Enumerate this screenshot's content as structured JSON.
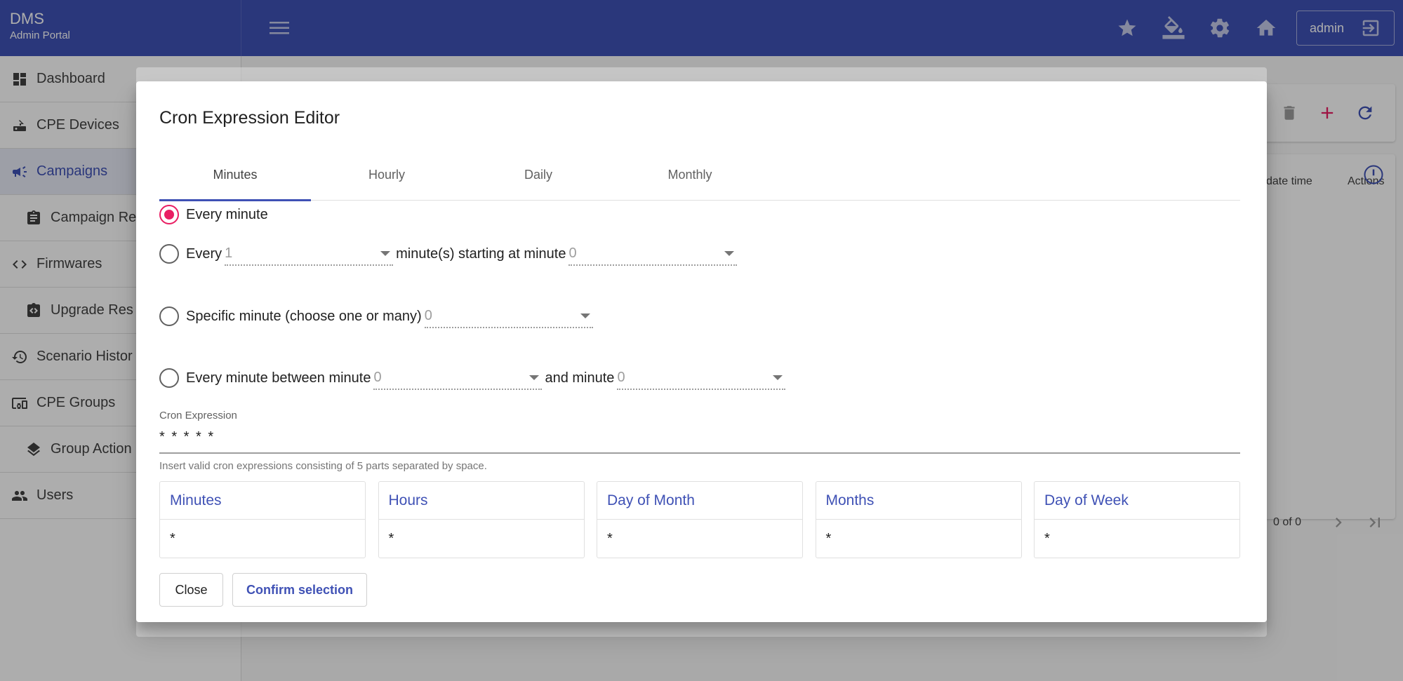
{
  "app": {
    "title": "DMS",
    "subtitle": "Admin Portal",
    "user_label": "admin"
  },
  "top_icons": [
    "star-icon",
    "paint-bucket-icon",
    "gear-icon",
    "home-icon"
  ],
  "sidebar": {
    "items": [
      {
        "label": "Dashboard",
        "icon": "dashboard-icon",
        "sub": false,
        "active": false
      },
      {
        "label": "CPE Devices",
        "icon": "router-icon",
        "sub": false,
        "active": false
      },
      {
        "label": "Campaigns",
        "icon": "megaphone-icon",
        "sub": false,
        "active": true
      },
      {
        "label": "Campaign Re",
        "icon": "clipboard-icon",
        "sub": true,
        "active": false
      },
      {
        "label": "Firmwares",
        "icon": "code-icon",
        "sub": false,
        "active": false
      },
      {
        "label": "Upgrade Res",
        "icon": "upgrade-icon",
        "sub": true,
        "active": false
      },
      {
        "label": "Scenario Histor",
        "icon": "history-icon",
        "sub": false,
        "active": false
      },
      {
        "label": "CPE Groups",
        "icon": "devices-icon",
        "sub": false,
        "active": false
      },
      {
        "label": "Group Action",
        "icon": "layers-icon",
        "sub": true,
        "active": false
      },
      {
        "label": "Users",
        "icon": "people-icon",
        "sub": false,
        "active": false
      }
    ]
  },
  "background": {
    "col_update_time": "date time",
    "col_actions": "Actions",
    "pagination": "0 of 0"
  },
  "dialog": {
    "title": "Cron Expression Editor",
    "tabs": [
      {
        "label": "Minutes",
        "active": true
      },
      {
        "label": "Hourly",
        "active": false
      },
      {
        "label": "Daily",
        "active": false
      },
      {
        "label": "Monthly",
        "active": false
      }
    ],
    "options": {
      "every_minute": "Every minute",
      "every": "Every",
      "every_value": "1",
      "starting_at": "minute(s) starting at minute",
      "starting_value": "0",
      "specific": "Specific minute (choose one or many)",
      "specific_value": "0",
      "between": "Every minute between minute",
      "between_from": "0",
      "and_minute": "and minute",
      "between_to": "0"
    },
    "cron": {
      "label": "Cron Expression",
      "value": "* * * * *",
      "hint": "Insert valid cron expressions consisting of 5 parts separated by space."
    },
    "parts": [
      {
        "label": "Minutes",
        "value": "*"
      },
      {
        "label": "Hours",
        "value": "*"
      },
      {
        "label": "Day of Month",
        "value": "*"
      },
      {
        "label": "Months",
        "value": "*"
      },
      {
        "label": "Day of Week",
        "value": "*"
      }
    ],
    "buttons": {
      "close": "Close",
      "confirm": "Confirm selection"
    }
  },
  "colors": {
    "primary": "#3f51b5",
    "accent": "#e91e63"
  }
}
